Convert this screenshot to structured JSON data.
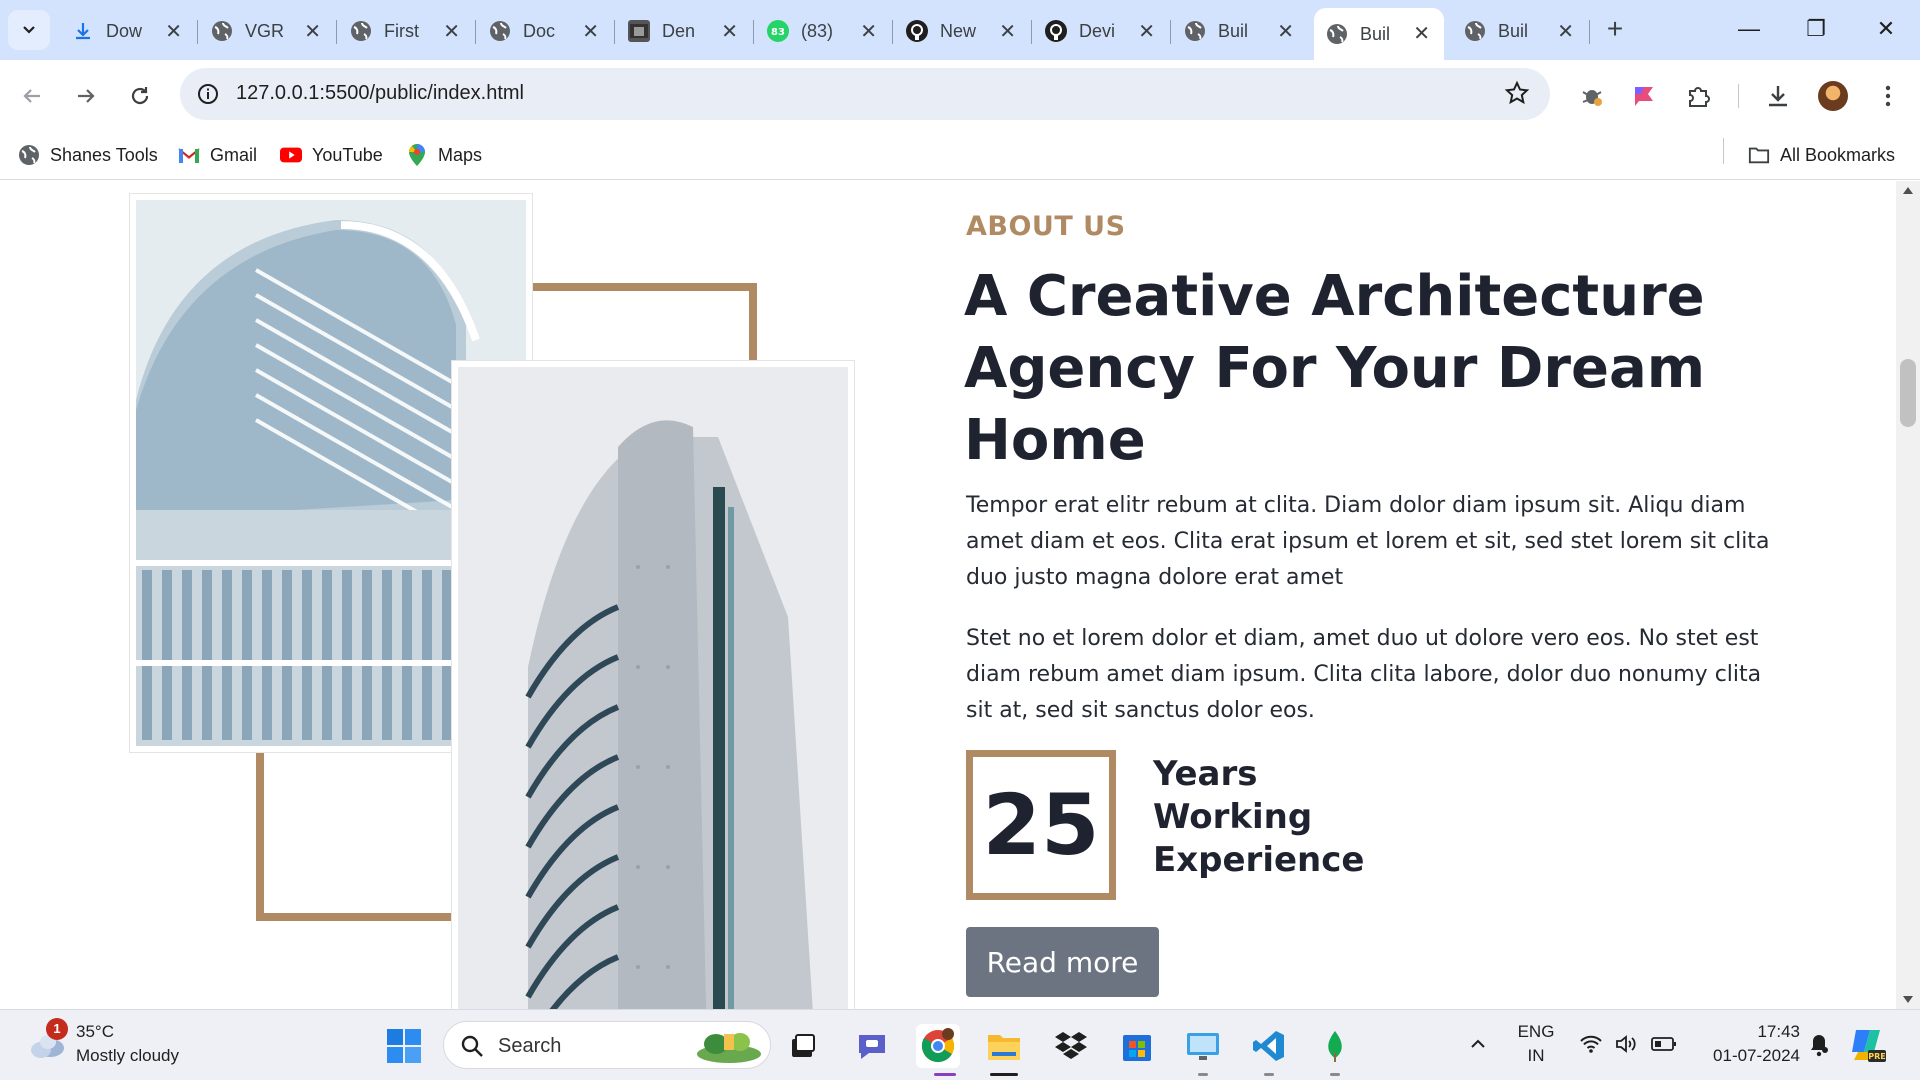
{
  "tabs": [
    {
      "label": "Dow",
      "icon": "download-icon"
    },
    {
      "label": "VGR",
      "icon": "globe-icon"
    },
    {
      "label": "First",
      "icon": "globe-icon"
    },
    {
      "label": "Doc",
      "icon": "globe-icon"
    },
    {
      "label": "Den",
      "icon": "image-icon"
    },
    {
      "label": "(83)",
      "icon": "whatsapp-icon"
    },
    {
      "label": "New",
      "icon": "github-icon"
    },
    {
      "label": "Devi",
      "icon": "github-icon"
    },
    {
      "label": "Buil",
      "icon": "globe-icon"
    },
    {
      "label": "Buil",
      "icon": "globe-icon",
      "active": true
    },
    {
      "label": "Buil",
      "icon": "globe-icon"
    }
  ],
  "address": {
    "url": "127.0.0.1:5500/public/index.html"
  },
  "bookmarks": [
    {
      "label": "Shanes Tools",
      "icon": "globe-icon"
    },
    {
      "label": "Gmail",
      "icon": "gmail-icon"
    },
    {
      "label": "YouTube",
      "icon": "youtube-icon"
    },
    {
      "label": "Maps",
      "icon": "maps-icon"
    }
  ],
  "all_bookmarks": "All Bookmarks",
  "about": {
    "kicker": "ABOUT US",
    "title": "A Creative Architecture Agency For Your Dream Home",
    "paragraph1": "Tempor erat elitr rebum at clita. Diam dolor diam ipsum sit. Aliqu diam amet diam et eos. Clita erat ipsum et lorem et sit, sed stet lorem sit clita duo justo magna dolore erat amet",
    "paragraph2": "Stet no et lorem dolor et diam, amet duo ut dolore vero eos. No stet est diam rebum amet diam ipsum. Clita clita labore, dolor duo nonumy clita sit at, sed sit sanctus dolor eos.",
    "years_number": "25",
    "years_line1": "Years",
    "years_line2": "Working",
    "years_line3": "Experience",
    "button": "Read more"
  },
  "colors": {
    "accent": "#b08a62",
    "button": "#6b7480",
    "heading": "#1f2330"
  },
  "taskbar": {
    "weather_temp": "35°C",
    "weather_desc": "Mostly cloudy",
    "weather_badge": "1",
    "search_placeholder": "Search",
    "lang_line1": "ENG",
    "lang_line2": "IN",
    "time": "17:43",
    "date": "01-07-2024"
  }
}
